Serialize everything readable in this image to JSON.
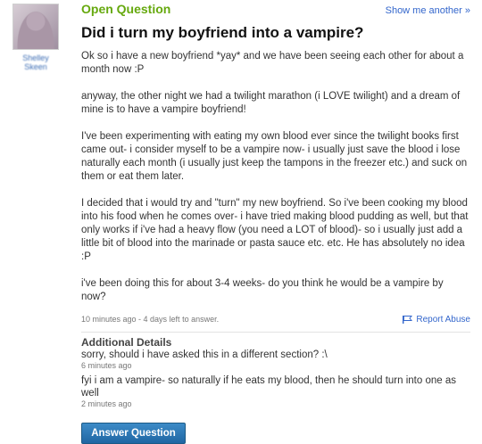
{
  "author": {
    "name": "Shelley Skeen"
  },
  "header": {
    "status_label": "Open Question",
    "show_another": "Show me another »"
  },
  "question": {
    "title": "Did i turn my boyfriend into a vampire?",
    "paragraphs": [
      "Ok so i have a new boyfriend *yay* and we have been seeing each other for about a month now :P",
      "anyway, the other night we had a twilight marathon (i LOVE twilight) and a dream of mine is to have a vampire boyfriend!",
      "I've been experimenting with eating my own blood ever since the twilight books first came out- i consider myself to be a vampire now- i usually just save the blood i lose naturally each month (i usually just keep the tampons in the freezer etc.) and suck on them or eat them later.",
      "I decided that i would try and \"turn\" my new boyfriend. So i've been cooking my blood into his food when he comes over- i have tried making blood pudding as well, but that only works if i've had a heavy flow (you need a LOT of blood)- so i usually just add a little bit of blood into the marinade or pasta sauce etc. etc. He has absolutely no idea :P",
      "i've been doing this for about 3-4 weeks- do you think he would be a vampire by now?"
    ],
    "meta": "10 minutes ago - 4 days left to answer.",
    "report_label": "Report Abuse"
  },
  "additional": {
    "title": "Additional Details",
    "details": [
      {
        "text": "sorry, should i have asked this in a different section? :\\",
        "time": "6 minutes ago"
      },
      {
        "text": "fyi i am a vampire- so naturally if he eats my blood, then he should turn into one as well",
        "time": "2 minutes ago"
      }
    ]
  },
  "answer_button": "Answer Question",
  "colors": {
    "status_green": "#66a90e",
    "link_blue": "#3366cc",
    "button_blue": "#2a74b3"
  },
  "icons": {
    "report": "flag-icon",
    "avatar": "user-avatar-photo"
  }
}
